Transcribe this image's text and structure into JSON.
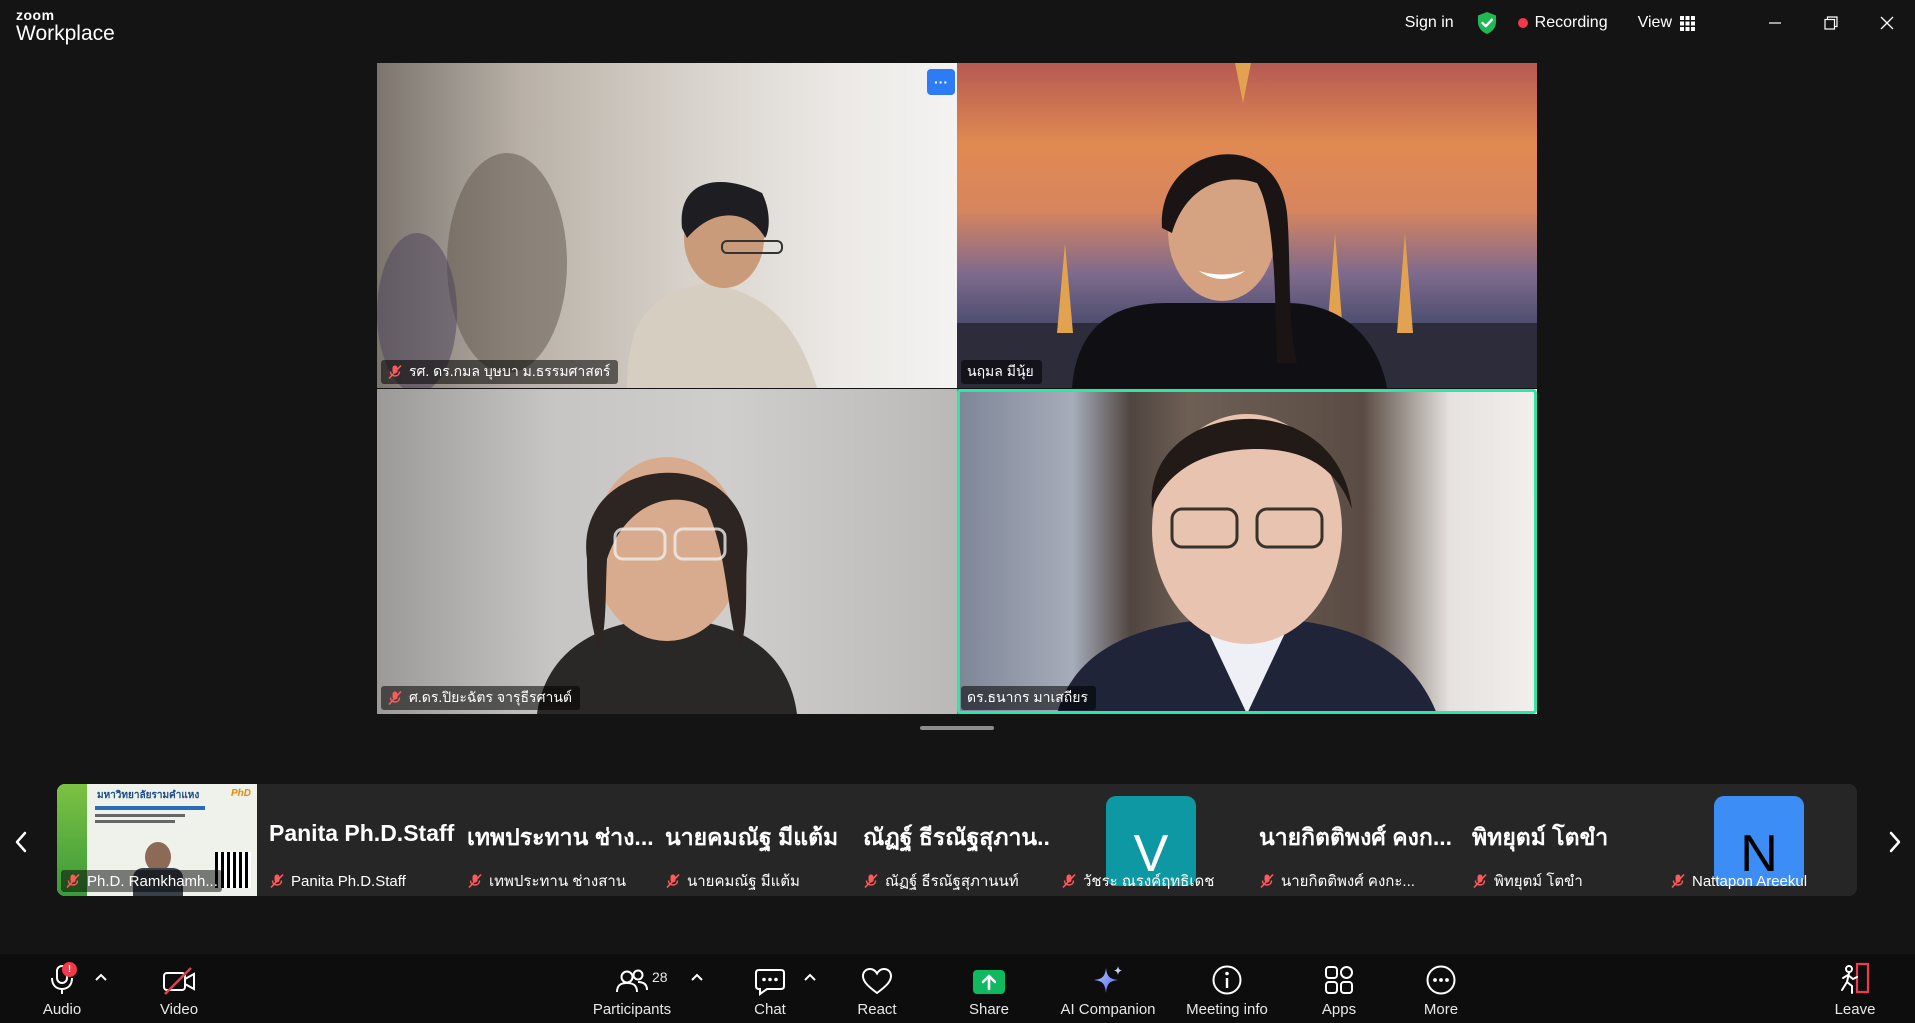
{
  "app": {
    "brand_top": "zoom",
    "brand_bottom": "Workplace"
  },
  "titlebar": {
    "sign_in": "Sign in",
    "recording": "Recording",
    "view": "View"
  },
  "video_tiles": [
    {
      "name": "รศ. ดร.กมล บุษบา ม.ธรรมศาสตร์",
      "muted": true,
      "active": false
    },
    {
      "name": "นฤมล มีนุ้ย",
      "muted": false,
      "active": false
    },
    {
      "name": "ศ.ดร.ปิยะฉัตร จารุธีรศานต์",
      "muted": true,
      "active": false
    },
    {
      "name": "ดร.ธนากร มาเสถียร",
      "muted": false,
      "active": true
    }
  ],
  "tile_menu": "···",
  "strip": [
    {
      "display": "",
      "label": "Ph.D. Ramkhamh...",
      "type": "shared"
    },
    {
      "display": "Panita Ph.D.Staff",
      "label": "Panita Ph.D.Staff",
      "type": "text"
    },
    {
      "display": "เทพประทาน ช่าง...",
      "label": "เทพประทาน ช่างสาน",
      "type": "text"
    },
    {
      "display": "นายคมณัฐ มีแต้ม",
      "label": "นายคมณัฐ มีแต้ม",
      "type": "text"
    },
    {
      "display": "ณัฏฐ์ ธีรณัฐสุภาน...",
      "label": "ณัฏฐ์ ธีรณัฐสุภานนท์",
      "type": "text"
    },
    {
      "display": "V",
      "label": "วัชระ ณรงค์ฤทธิเดช",
      "type": "avatar",
      "color": "#0e98a3"
    },
    {
      "display": "นายกิตติพงศ์ คงก...",
      "label": "นายกิตติพงศ์ คงกะ...",
      "type": "text"
    },
    {
      "display": "พิทยุตม์ โตขำ",
      "label": "พิทยุตม์ โตขำ",
      "type": "text"
    },
    {
      "display": "N",
      "label": "Nattapon Areekul",
      "type": "avatar",
      "color": "#3c8df5"
    }
  ],
  "shared_screen": {
    "university": "มหาวิทยาลัยรามคำแหง",
    "badge": "PhD"
  },
  "toolbar": {
    "audio": "Audio",
    "audio_badge": "!",
    "video": "Video",
    "participants": "Participants",
    "participant_count": "28",
    "chat": "Chat",
    "react": "React",
    "share": "Share",
    "ai": "AI Companion",
    "meeting_info": "Meeting info",
    "apps": "Apps",
    "more": "More",
    "leave": "Leave"
  },
  "colors": {
    "active_speaker": "#2ee6a6",
    "recording": "#f0394a",
    "share": "#10b860",
    "leave": "#f0394a"
  }
}
